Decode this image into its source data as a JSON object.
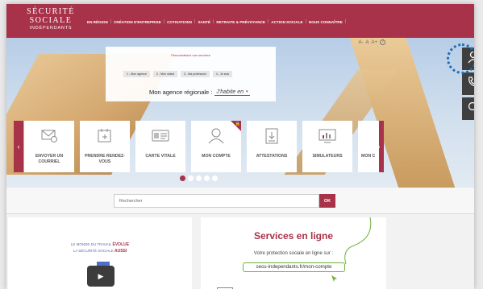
{
  "header": {
    "logo": {
      "line1": "SÉCURITÉ",
      "line2": "SOCIALE",
      "line3": "INDÉPENDANTS"
    },
    "nav": [
      "EN RÉGION",
      "CRÉATION D'ENTREPRISE",
      "COTISATIONS",
      "SANTÉ",
      "RETRAITE & PRÉVOYANCE",
      "ACTION SOCIALE",
      "NOUS CONNAÎTRE"
    ]
  },
  "text_size": {
    "a_small": "A-",
    "a_normal": "A",
    "a_large": "A+",
    "help": "?"
  },
  "agency_search": {
    "title": "Personnalisez nos services",
    "steps": [
      "1 - Mon agence",
      "2 - Mon statut",
      "3 - Ma profession",
      "4 - Je suis"
    ],
    "region_label": "Mon agence régionale :",
    "region_value": "J'habite en",
    "chevron": "▾"
  },
  "carousel": {
    "prev": "‹",
    "next": "›",
    "tiles": [
      {
        "label": "ENVOYER UN COURRIEL",
        "icon": "envelope-icon"
      },
      {
        "label": "PRENDRE RENDEZ-VOUS",
        "icon": "calendar-icon"
      },
      {
        "label": "CARTE VITALE",
        "icon": "card-icon"
      },
      {
        "label": "MON COMPTE",
        "icon": "user-icon",
        "locked": true
      },
      {
        "label": "ATTESTATIONS",
        "icon": "download-doc-icon"
      },
      {
        "label": "SIMULATEURS",
        "icon": "chart-screen-icon"
      },
      {
        "label": "MON C",
        "icon": "partial-icon"
      }
    ],
    "dots": 5,
    "active_dot": 0
  },
  "side_tools": [
    "user-icon",
    "phone-icon",
    "search-icon"
  ],
  "search": {
    "placeholder": "Rechercher",
    "button": "OK"
  },
  "video": {
    "line1": "LE MONDE DU TRAVAIL",
    "line1_accent": "ÉVOLUE",
    "line2": "LA SÉCURITÉ SOCIALE",
    "line2_accent": "AUSSI",
    "play": "▶"
  },
  "online": {
    "title": "Services en ligne",
    "subtitle": "Votre protection sociale en ligne sur :",
    "link": "secu-independants.fr/mon-compte"
  },
  "colors": {
    "brand": "#a8324a",
    "dark_tool": "#3f3f3f",
    "highlight": "#1f6fb8",
    "green": "#6fb13a"
  }
}
